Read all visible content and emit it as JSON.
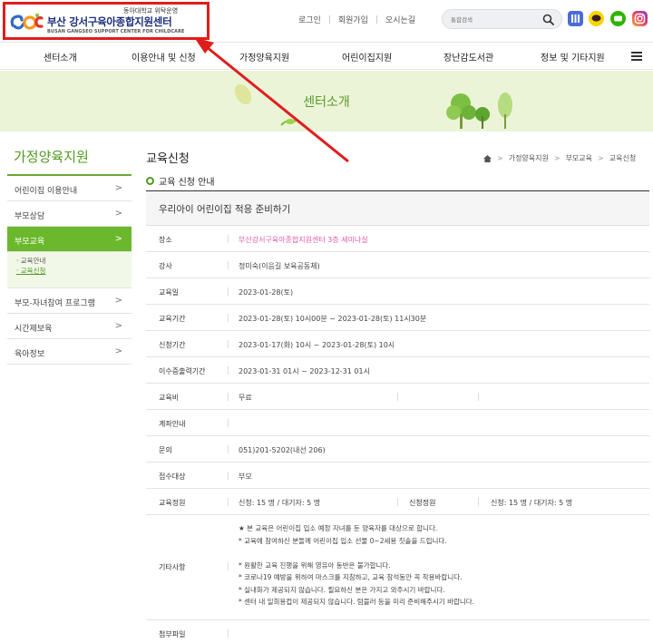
{
  "header": {
    "logo_sub": "동아대학교 위탁운영",
    "logo_main": "부산 강서구육아종합지원센터",
    "logo_en": "BUSAN GANGSEO SUPPORT CENTER FOR CHILDCARE",
    "links": [
      "로그인",
      "회원가입",
      "오시는길"
    ],
    "search_placeholder": "통합검색"
  },
  "gnb": [
    "센터소개",
    "이용안내 및 신청",
    "가정양육지원",
    "어린이집지원",
    "장난감도서관",
    "정보 및 기타지원"
  ],
  "banner_title": "센터소개",
  "sidebar": {
    "title": "가정양육지원",
    "items": [
      {
        "label": "어린이집 이용안내"
      },
      {
        "label": "부모상담"
      },
      {
        "label": "부모교육",
        "active": true
      },
      {
        "label": "부모-자녀참여 프로그램"
      },
      {
        "label": "시간제보육"
      },
      {
        "label": "육아정보"
      }
    ],
    "subitems": [
      "교육안내",
      "교육신청"
    ]
  },
  "content": {
    "title": "교육신청",
    "breadcrumb": [
      "가정양육지원",
      "부모교육",
      "교육신청"
    ],
    "section": "교육 신청 안내",
    "course": "우리아이 어린이집 적응 준비하기",
    "rows": {
      "place": {
        "label": "장소",
        "value": "부산강서구육아종합지원센터 3층 세미나실"
      },
      "teacher": {
        "label": "강사",
        "value": "정미숙(이음길 보육공동체)"
      },
      "date": {
        "label": "교육일",
        "value": "2023-01-28(토)"
      },
      "period": {
        "label": "교육기간",
        "value": "2023-01-28(토) 10시00분 ~ 2023-01-28(토) 11시30분"
      },
      "apply": {
        "label": "신청기간",
        "value": "2023-01-17(화) 10시 ~ 2023-01-28(토) 10시"
      },
      "cert": {
        "label": "이수증출력기간",
        "value": "2023-01-31 01시 ~ 2023-12-31 01시"
      },
      "fee": {
        "label": "교육비",
        "value": "무료"
      },
      "account": {
        "label": "계좌안내",
        "value": ""
      },
      "contact": {
        "label": "문의",
        "value": "051)201-5202(내선 206)"
      },
      "target": {
        "label": "접수대상",
        "value": "부모"
      },
      "capacity": {
        "label": "교육정원",
        "value": "신청: 15 명 / 대기자: 5 명",
        "label2": "신청정원",
        "value2": "신청: 15 명 / 대기자: 5 명"
      },
      "etc": {
        "label": "기타사항"
      },
      "attach": {
        "label": "첨부파일",
        "value": ""
      }
    },
    "notes": [
      "★ 본 교육은 어린이집 입소 예정 자녀를 둔 양육자를 대상으로 합니다.",
      "* 교육에 참여하신 분들께 어린이집 입소 선물 0~2세용 칫솔을 드립니다.",
      "* 원활한 교육 진행을 위해 영유아 동반은 불가합니다.",
      "* 코로나19 예방을 위하여 마스크를 지참하고, 교육 참석동안 꼭 착용바랍니다.",
      "* 실내화가 제공되지 않습니다. 필요하신 분은 가지고 와주시기 바랍니다.",
      "* 센터 내 일회용컵이 제공되지 않습니다. 텀블러 등을 미리 준비해주시기 바랍니다."
    ]
  },
  "colors": {
    "accent_green": "#6bb82c",
    "annotation_red": "#e01d1d",
    "place_pink": "#e05aa8"
  }
}
